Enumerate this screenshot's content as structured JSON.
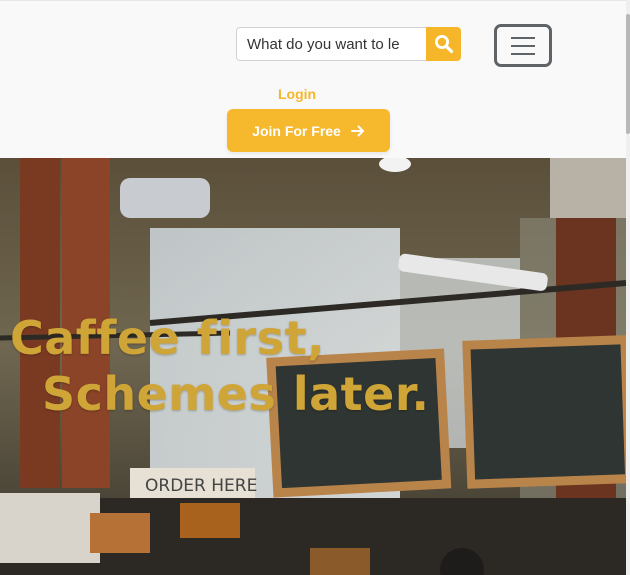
{
  "search": {
    "placeholder": "What do you want to le",
    "icon": "search-icon"
  },
  "menu": {
    "icon": "hamburger-menu-icon"
  },
  "nav": {
    "login_label": "Login"
  },
  "cta": {
    "join_label": "Join For Free",
    "icon": "arrow-right-icon"
  },
  "hero": {
    "headline_line1": "Caffee first,",
    "headline_line2": "Schemes later.",
    "headline_color": "#d0a537",
    "photo_sign": "ORDER HERE"
  },
  "theme": {
    "accent": "#f5b62a",
    "menu_border": "#5e6368"
  }
}
